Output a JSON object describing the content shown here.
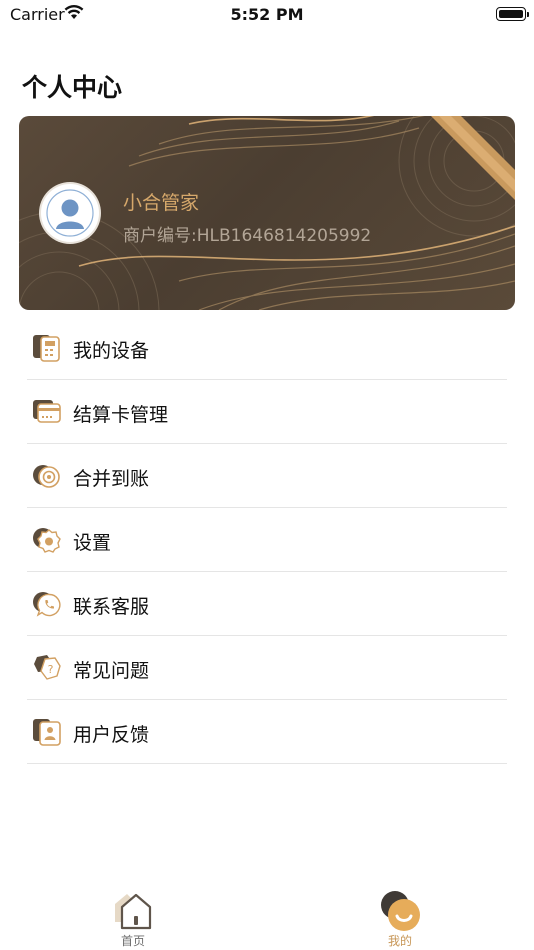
{
  "status_bar": {
    "carrier": "Carrier",
    "time": "5:52 PM"
  },
  "page": {
    "title": "个人中心"
  },
  "profile": {
    "name": "小合管家",
    "merchant_id": "商户编号:HLB1646814205992"
  },
  "menu": [
    {
      "label": "我的设备",
      "icon": "device-icon"
    },
    {
      "label": "结算卡管理",
      "icon": "card-icon"
    },
    {
      "label": "合并到账",
      "icon": "merge-icon"
    },
    {
      "label": "设置",
      "icon": "gear-icon"
    },
    {
      "label": "联系客服",
      "icon": "phone-chat-icon"
    },
    {
      "label": "常见问题",
      "icon": "question-icon"
    },
    {
      "label": "用户反馈",
      "icon": "feedback-icon"
    }
  ],
  "tabbar": {
    "home": {
      "label": "首页",
      "icon": "home-icon"
    },
    "mine": {
      "label": "我的",
      "icon": "smile-face-icon"
    }
  },
  "colors": {
    "accent": "#C79656",
    "card_bg": "#4F4236",
    "text": "#111111"
  }
}
